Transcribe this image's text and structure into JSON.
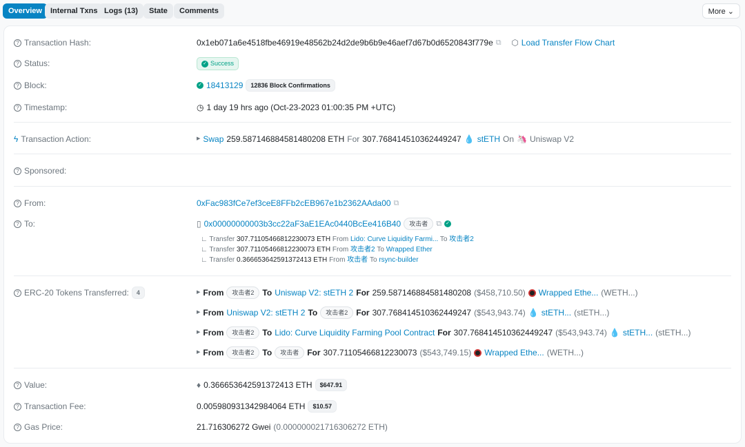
{
  "tabs": [
    "Overview",
    "Internal Txns",
    "Logs (13)",
    "State",
    "Comments"
  ],
  "more": "More",
  "hash": {
    "label": "Transaction Hash:",
    "value": "0x1eb071a6e4518fbe46919e48562b24d2de9b6b9e46aef7d67b0d6520843f779e",
    "flow": "Load Transfer Flow Chart"
  },
  "status": {
    "label": "Status:",
    "value": "Success"
  },
  "block": {
    "label": "Block:",
    "value": "18413129",
    "conf": "12836 Block Confirmations"
  },
  "timestamp": {
    "label": "Timestamp:",
    "value": "1 day 19 hrs ago (Oct-23-2023 01:00:35 PM +UTC)"
  },
  "action": {
    "label": "Transaction Action:",
    "swap": "Swap",
    "amt": "259.587146884581480208 ETH",
    "for": "For",
    "amt2": "307.768414510362449247",
    "token": "stETH",
    "on": "On",
    "dex": "Uniswap V2"
  },
  "sponsored": {
    "label": "Sponsored:"
  },
  "from": {
    "label": "From:",
    "value": "0xFac983fCe7ef3ceE8FFb2cEB967e1b2362AAda00"
  },
  "to": {
    "label": "To:",
    "value": "0x00000000003b3cc22aF3aE1EAc0440BcEe416B40",
    "tag": "攻击者",
    "transfers": [
      {
        "t": "Transfer",
        "amt": "307.71105466812230073 ETH",
        "from": "From",
        "src": "Lido: Curve Liquidity Farmi...",
        "to": "To",
        "dst": "攻击者2"
      },
      {
        "t": "Transfer",
        "amt": "307.71105466812230073 ETH",
        "from": "From",
        "src": "攻击者2",
        "to": "To",
        "dst": "Wrapped Ether"
      },
      {
        "t": "Transfer",
        "amt": "0.366653642591372413 ETH",
        "from": "From",
        "src": "攻击者",
        "to": "To",
        "dst": "rsync-builder"
      }
    ]
  },
  "erc20": {
    "label": "ERC-20 Tokens Transferred:",
    "count": "4",
    "rows": [
      {
        "from": "From",
        "src": "攻击者2",
        "to": "To",
        "dst": "Uniswap V2: stETH 2",
        "for": "For",
        "amt": "259.587146884581480208",
        "usd": "($458,710.50)",
        "token": "Wrapped Ethe...",
        "sym": "(WETH...)"
      },
      {
        "from": "From",
        "src": "Uniswap V2: stETH 2",
        "to": "To",
        "dst": "攻击者2",
        "for": "For",
        "amt": "307.768414510362449247",
        "usd": "($543,943.74)",
        "token": "stETH...",
        "sym": "(stETH...)"
      },
      {
        "from": "From",
        "src": "攻击者2",
        "to": "To",
        "dst": "Lido: Curve Liquidity Farming Pool Contract",
        "for": "For",
        "amt": "307.768414510362449247",
        "usd": "($543,943.74)",
        "token": "stETH...",
        "sym": "(stETH...)"
      },
      {
        "from": "From",
        "src": "攻击者2",
        "to": "To",
        "dst": "攻击者",
        "for": "For",
        "amt": "307.71105466812230073",
        "usd": "($543,749.15)",
        "token": "Wrapped Ethe...",
        "sym": "(WETH...)"
      }
    ]
  },
  "value": {
    "label": "Value:",
    "value": "0.366653642591372413 ETH",
    "usd": "$647.91"
  },
  "fee": {
    "label": "Transaction Fee:",
    "value": "0.005980931342984064 ETH",
    "usd": "$10.57"
  },
  "gas": {
    "label": "Gas Price:",
    "value": "21.716306272 Gwei",
    "eth": "(0.000000021716306272 ETH)"
  }
}
